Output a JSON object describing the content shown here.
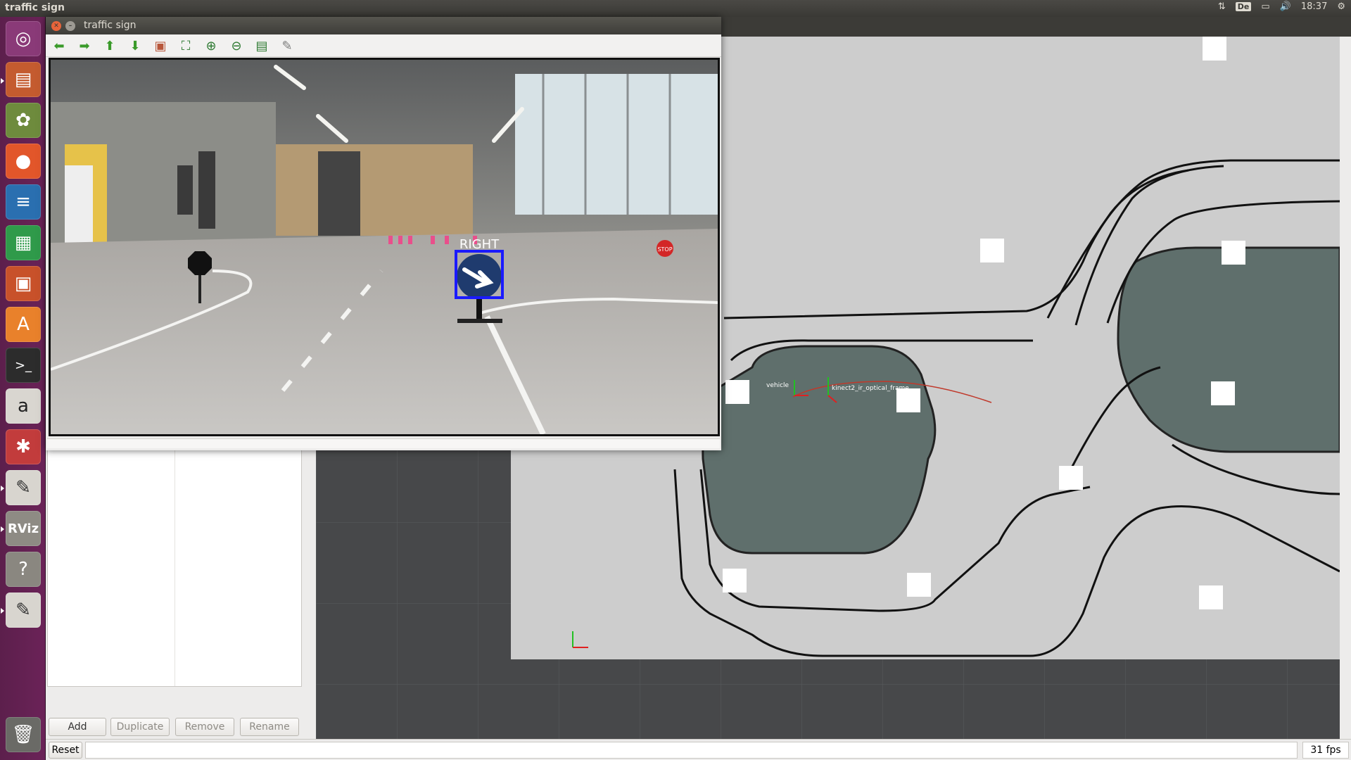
{
  "top_panel": {
    "app_title": "traffic sign",
    "keyboard_layout": "De",
    "clock": "18:37"
  },
  "launcher": {
    "items": [
      {
        "name": "dash-home",
        "icon": "ubuntu-logo-icon"
      },
      {
        "name": "files",
        "icon": "file-manager-icon"
      },
      {
        "name": "image-viewer",
        "icon": "image-viewer-icon"
      },
      {
        "name": "firefox",
        "icon": "firefox-icon"
      },
      {
        "name": "writer",
        "icon": "libreoffice-writer-icon"
      },
      {
        "name": "calc",
        "icon": "libreoffice-calc-icon"
      },
      {
        "name": "impress",
        "icon": "libreoffice-impress-icon"
      },
      {
        "name": "software-center",
        "icon": "software-center-icon"
      },
      {
        "name": "terminal",
        "icon": "terminal-icon"
      },
      {
        "name": "amazon",
        "icon": "amazon-icon"
      },
      {
        "name": "system-settings",
        "icon": "settings-icon"
      },
      {
        "name": "text-editor",
        "icon": "text-editor-icon"
      },
      {
        "name": "rviz",
        "icon": "rviz-icon",
        "label": "RViz"
      },
      {
        "name": "help",
        "icon": "help-icon"
      },
      {
        "name": "text-editor-2",
        "icon": "text-editor-icon"
      },
      {
        "name": "trash",
        "icon": "trash-icon"
      }
    ]
  },
  "image_window": {
    "title": "traffic sign",
    "toolbar_icons": [
      "back-arrow-icon",
      "forward-arrow-icon",
      "up-arrow-icon",
      "down-arrow-icon",
      "image-icon",
      "zoom-fit-icon",
      "zoom-in-icon",
      "zoom-out-icon",
      "save-icon",
      "pen-icon"
    ],
    "detection_label": "RIGHT",
    "stop_sign_text": "STOP"
  },
  "rviz": {
    "panel_buttons": {
      "add": "Add",
      "duplicate": "Duplicate",
      "remove": "Remove",
      "rename": "Rename"
    },
    "reset": "Reset",
    "fps": "31 fps",
    "frame_labels": {
      "kinect": "kinect2_ir_optical_frame",
      "vehicle": "vehicle"
    }
  },
  "colors": {
    "launcher": "#6b2358",
    "panel": "#3c3b37",
    "map_free": "#cdcdcd",
    "map_obstacle": "#5f6f6c",
    "detection_box": "#1a1aff"
  }
}
